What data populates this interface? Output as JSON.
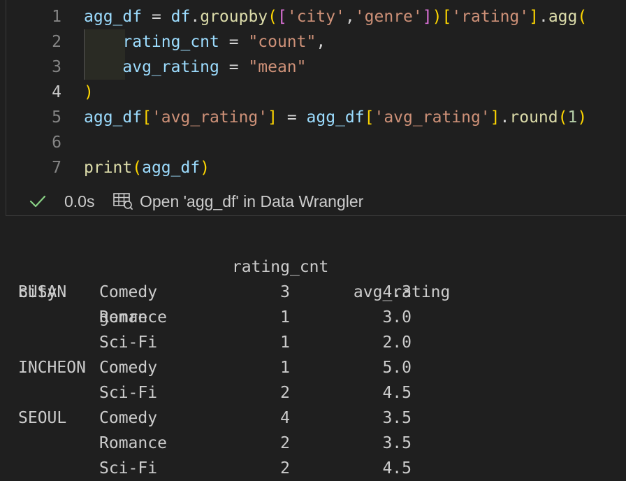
{
  "code": {
    "line_numbers": [
      "1",
      "2",
      "3",
      "4",
      "5",
      "6",
      "7"
    ],
    "active_line": "4",
    "lines": [
      [
        {
          "t": "agg_df",
          "c": "v"
        },
        {
          "t": " = ",
          "c": "op"
        },
        {
          "t": "df",
          "c": "v"
        },
        {
          "t": ".",
          "c": "op"
        },
        {
          "t": "groupby",
          "c": "fn"
        },
        {
          "t": "(",
          "c": "b1"
        },
        {
          "t": "[",
          "c": "b2"
        },
        {
          "t": "'city'",
          "c": "str"
        },
        {
          "t": ",",
          "c": "op"
        },
        {
          "t": "'genre'",
          "c": "str"
        },
        {
          "t": "]",
          "c": "b2"
        },
        {
          "t": ")",
          "c": "b1"
        },
        {
          "t": "[",
          "c": "b1"
        },
        {
          "t": "'rating'",
          "c": "str"
        },
        {
          "t": "]",
          "c": "b1"
        },
        {
          "t": ".",
          "c": "op"
        },
        {
          "t": "agg",
          "c": "fn"
        },
        {
          "t": "(",
          "c": "b1"
        }
      ],
      [
        {
          "t": "    ",
          "c": "op"
        },
        {
          "t": "rating_cnt",
          "c": "v"
        },
        {
          "t": " = ",
          "c": "op"
        },
        {
          "t": "\"count\"",
          "c": "str"
        },
        {
          "t": ",",
          "c": "op"
        }
      ],
      [
        {
          "t": "    ",
          "c": "op"
        },
        {
          "t": "avg_rating",
          "c": "v"
        },
        {
          "t": " = ",
          "c": "op"
        },
        {
          "t": "\"mean\"",
          "c": "str"
        }
      ],
      [
        {
          "t": ")",
          "c": "b1"
        }
      ],
      [
        {
          "t": "agg_df",
          "c": "v"
        },
        {
          "t": "[",
          "c": "b1"
        },
        {
          "t": "'avg_rating'",
          "c": "str"
        },
        {
          "t": "]",
          "c": "b1"
        },
        {
          "t": " = ",
          "c": "op"
        },
        {
          "t": "agg_df",
          "c": "v"
        },
        {
          "t": "[",
          "c": "b1"
        },
        {
          "t": "'avg_rating'",
          "c": "str"
        },
        {
          "t": "]",
          "c": "b1"
        },
        {
          "t": ".",
          "c": "op"
        },
        {
          "t": "round",
          "c": "fn"
        },
        {
          "t": "(",
          "c": "b1"
        },
        {
          "t": "1",
          "c": "num"
        },
        {
          "t": ")",
          "c": "b1"
        }
      ],
      [],
      [
        {
          "t": "print",
          "c": "fn"
        },
        {
          "t": "(",
          "c": "b1"
        },
        {
          "t": "agg_df",
          "c": "v"
        },
        {
          "t": ")",
          "c": "b1"
        }
      ]
    ]
  },
  "status": {
    "check_icon": "check-icon",
    "exec_time": "0.0s",
    "wrangler_icon": "table-icon",
    "wrangler_label": "Open 'agg_df' in Data Wrangler",
    "check_color": "#89d185"
  },
  "output": {
    "columns": [
      "rating_cnt",
      "avg_rating"
    ],
    "index_names": [
      "city",
      "genre"
    ],
    "rows": [
      {
        "city": "BUSAN",
        "genre": "Comedy",
        "rating_cnt": "3",
        "avg_rating": "4.3"
      },
      {
        "city": "",
        "genre": "Romance",
        "rating_cnt": "1",
        "avg_rating": "3.0"
      },
      {
        "city": "",
        "genre": "Sci-Fi",
        "rating_cnt": "1",
        "avg_rating": "2.0"
      },
      {
        "city": "INCHEON",
        "genre": "Comedy",
        "rating_cnt": "1",
        "avg_rating": "5.0"
      },
      {
        "city": "",
        "genre": "Sci-Fi",
        "rating_cnt": "2",
        "avg_rating": "4.5"
      },
      {
        "city": "SEOUL",
        "genre": "Comedy",
        "rating_cnt": "4",
        "avg_rating": "3.5"
      },
      {
        "city": "",
        "genre": "Romance",
        "rating_cnt": "2",
        "avg_rating": "3.5"
      },
      {
        "city": "",
        "genre": "Sci-Fi",
        "rating_cnt": "2",
        "avg_rating": "4.5"
      }
    ]
  }
}
